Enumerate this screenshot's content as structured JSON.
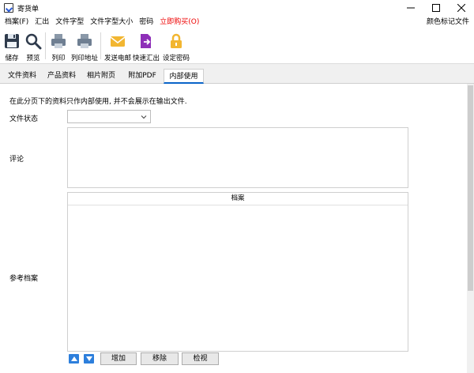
{
  "window": {
    "title": "寄货单"
  },
  "menu": {
    "items": [
      "档案(F)",
      "汇出",
      "文件字型",
      "文件字型大小",
      "密码"
    ],
    "buy": "立即购买(O)",
    "right": "颜色标记文件"
  },
  "toolbar": {
    "save": "储存",
    "preview": "预览",
    "print": "列印",
    "print_address": "列印地址",
    "send_email": "发送电邮",
    "quick_export": "快速汇出",
    "set_password": "设定密码"
  },
  "tabs": [
    "文件资料",
    "产品资料",
    "相片附页",
    "附加PDF",
    "内部使用"
  ],
  "main": {
    "info": "在此分页下的资料只作内部使用, 并不会展示在输出文件.",
    "status_label": "文件状态",
    "status_value": "",
    "comment_label": "评论",
    "ref_label": "参考档案",
    "archive_header": "档案",
    "add": "增加",
    "remove": "移除",
    "view": "检视"
  },
  "colors": {
    "accent": "#0a64c8",
    "buy": "#ee0000",
    "arrow": "#2d7fdc"
  }
}
